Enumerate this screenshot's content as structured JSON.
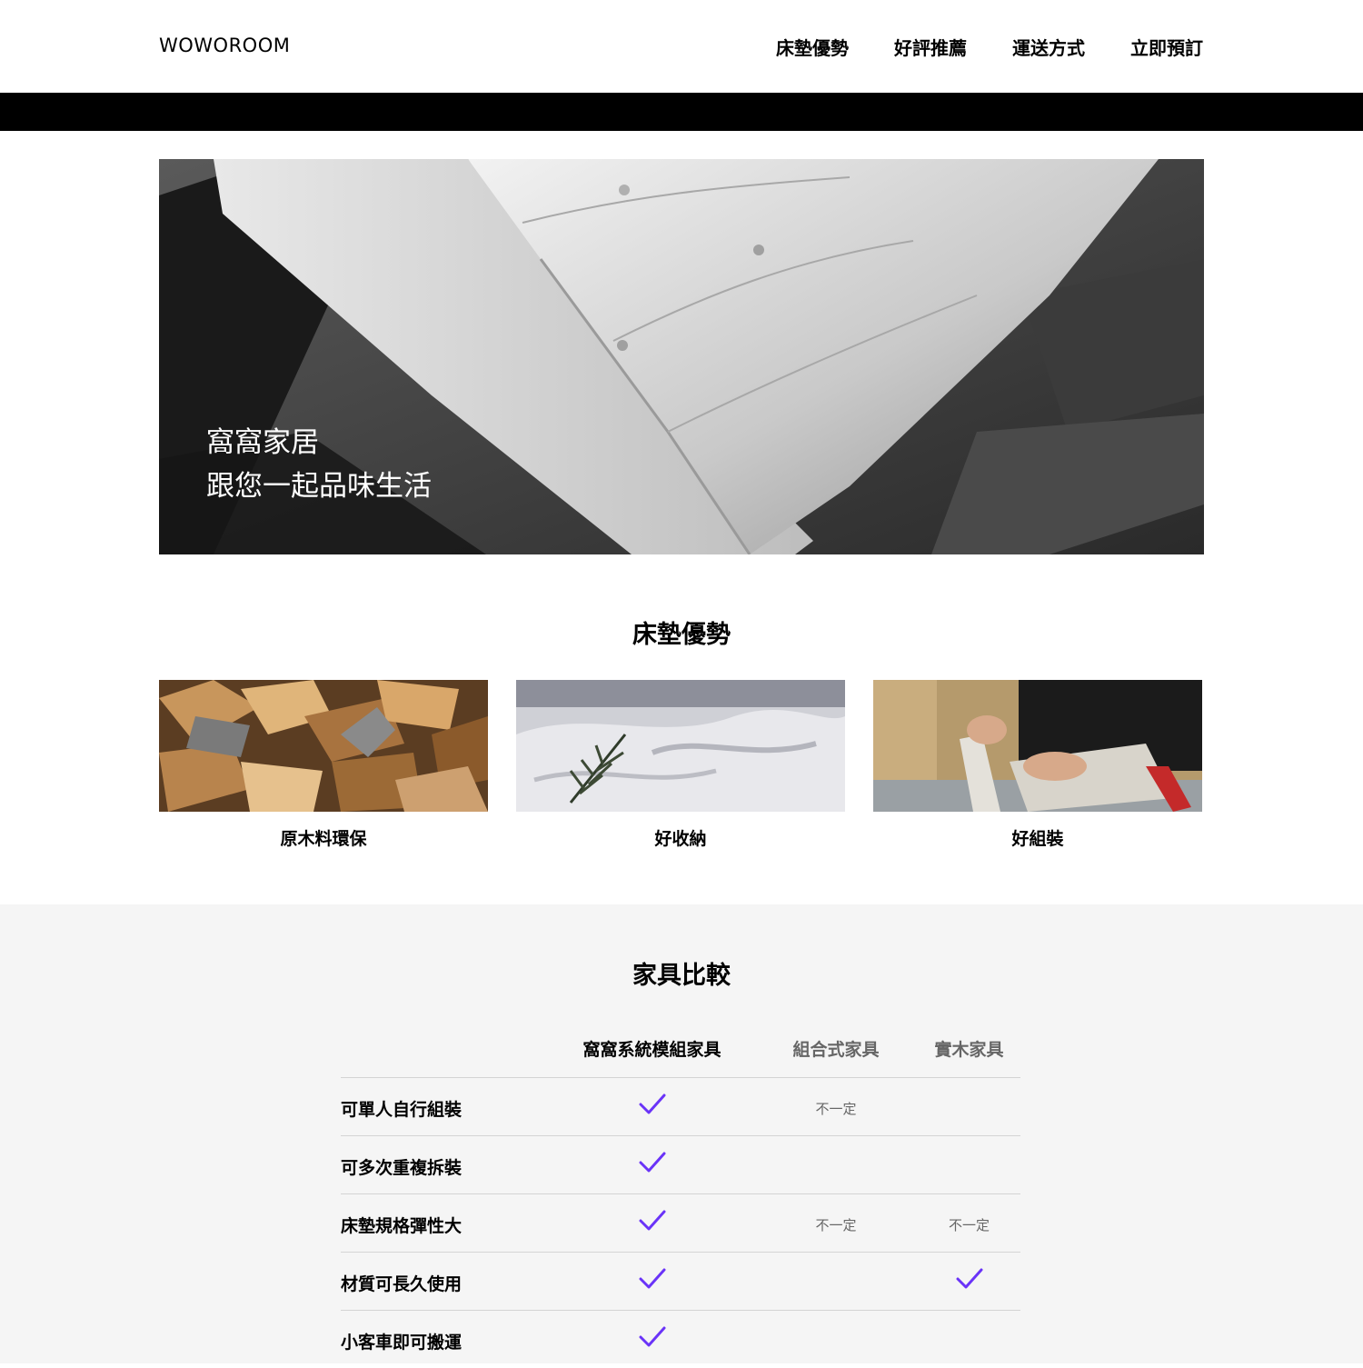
{
  "header": {
    "logo": "WOWOROOM",
    "nav": [
      "床墊優勢",
      "好評推薦",
      "運送方式",
      "立即預訂"
    ]
  },
  "hero": {
    "line1": "窩窩家居",
    "line2": "跟您一起品味生活"
  },
  "features": {
    "title": "床墊優勢",
    "items": [
      "原木料環保",
      "好收納",
      "好組裝"
    ]
  },
  "compare": {
    "title": "家具比較",
    "columns": [
      "窩窩系統模組家具",
      "組合式家具",
      "實木家具"
    ],
    "rows": [
      {
        "label": "可單人自行組裝",
        "cells": [
          "check",
          "不一定",
          ""
        ]
      },
      {
        "label": "可多次重複拆裝",
        "cells": [
          "check",
          "",
          ""
        ]
      },
      {
        "label": "床墊規格彈性大",
        "cells": [
          "check",
          "不一定",
          "不一定"
        ]
      },
      {
        "label": "材質可長久使用",
        "cells": [
          "check",
          "",
          "check"
        ]
      },
      {
        "label": "小客車即可搬運",
        "cells": [
          "check",
          "",
          ""
        ]
      }
    ],
    "check_color": "#6a33f8"
  }
}
